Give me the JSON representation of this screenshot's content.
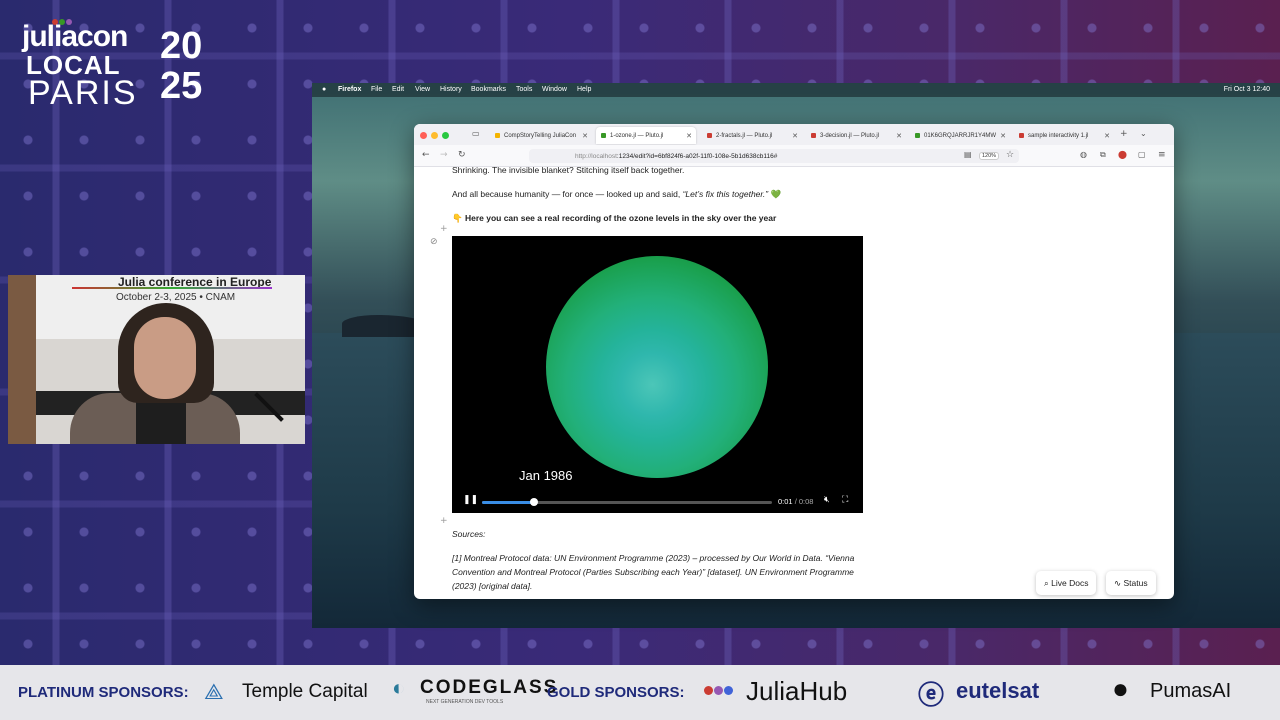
{
  "logo": {
    "line1": "juliacon",
    "line2": "LOCAL",
    "line3": "PARIS",
    "year_top": "20",
    "year_bottom": "25",
    "dot_colors": [
      "#cb3c33",
      "#389826",
      "#9558b2"
    ]
  },
  "webcam": {
    "banner_title": "Julia conference in Europe",
    "banner_date": "October 2-3, 2025 • CNAM"
  },
  "menubar": {
    "app": "Firefox",
    "items": [
      "File",
      "Edit",
      "View",
      "History",
      "Bookmarks",
      "Tools",
      "Window",
      "Help"
    ],
    "clock": "Fri Oct 3  12:40"
  },
  "browser": {
    "tabs": [
      {
        "label": "CompStoryTelling JuliaCon",
        "favicon_color": "#f4b400"
      },
      {
        "label": "1-ozone.jl — Pluto.jl",
        "favicon_color": "#389826"
      },
      {
        "label": "2-fractals.jl — Pluto.jl",
        "favicon_color": "#cb3c33"
      },
      {
        "label": "3-decision.jl — Pluto.jl",
        "favicon_color": "#cb3c33"
      },
      {
        "label": "01K6GRQJARRJR1Y4MW",
        "favicon_color": "#389826"
      },
      {
        "label": "sample interactivity 1.jl",
        "favicon_color": "#cb3c33"
      }
    ],
    "new_tab": "+",
    "url_host": "http://localhost",
    "url_rest": ":1234/edit?id=6bf824f6-a02f-11f0-108e-5b1d638cb116#",
    "zoom": "120%"
  },
  "notebook": {
    "line_top": "Shrinking. The invisible blanket? Stitching itself back together.",
    "line_humanity": "And all because humanity — for once — looked up and said, ",
    "quote": "“Let’s fix this together.”",
    "heart": "💚",
    "hint_emoji": "👇",
    "hint": "Here you can see a real recording of the ozone levels in the sky over the year",
    "video": {
      "date": "Jan  1986",
      "progress": 0.18,
      "current": "0:01",
      "total": " / 0:08"
    },
    "sources_label": "Sources:",
    "source1_line1": "[1] Montreal Protocol data: UN Environment Programme (2023) – processed by Our World in Data. “Vienna",
    "source1_line2": "Convention and Montreal Protocol (Parties Subscribing each Year)” [dataset]. UN Environment Programme",
    "source1_line3": "(2023) [original data].",
    "live_docs": "Live Docs",
    "status": "Status"
  },
  "sponsors": {
    "platinum_label": "PLATINUM SPONSORS:",
    "temple": "Temple Capital",
    "codeglass": "CODEGLASS",
    "codeglass_tag": "NEXT GENERATION DEV TOOLS",
    "gold_label": "GOLD SPONSORS:",
    "juliahub": "JuliaHub",
    "eutelsat": "eutelsat",
    "pumas": "PumasAI"
  }
}
